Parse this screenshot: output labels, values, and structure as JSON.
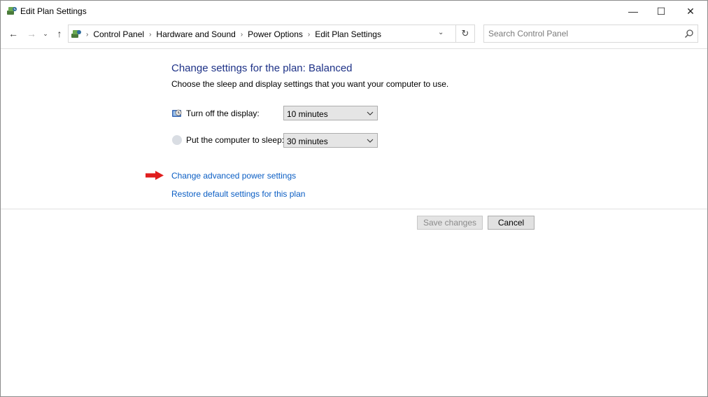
{
  "window": {
    "title": "Edit Plan Settings",
    "controls": {
      "minimize": "—",
      "maximize": "☐",
      "close": "✕"
    }
  },
  "nav": {
    "back": "←",
    "forward": "→",
    "recent": "⌄",
    "up": "↑",
    "breadcrumb": [
      "Control Panel",
      "Hardware and Sound",
      "Power Options",
      "Edit Plan Settings"
    ],
    "separator": "›",
    "dropdown": "⌄",
    "refresh": "↻",
    "search_placeholder": "Search Control Panel"
  },
  "content": {
    "heading": "Change settings for the plan: Balanced",
    "subtext": "Choose the sleep and display settings that you want your computer to use.",
    "settings": [
      {
        "label": "Turn off the display:",
        "value": "10 minutes",
        "icon": "monitor-power-icon"
      },
      {
        "label": "Put the computer to sleep:",
        "value": "30 minutes",
        "icon": "sleep-moon-icon"
      }
    ],
    "links": {
      "advanced": "Change advanced power settings",
      "restore": "Restore default settings for this plan"
    },
    "arrow_color": "#e01e1e"
  },
  "buttons": {
    "save": "Save changes",
    "cancel": "Cancel"
  },
  "colors": {
    "heading": "#1e3287",
    "link": "#0b5ec4"
  }
}
